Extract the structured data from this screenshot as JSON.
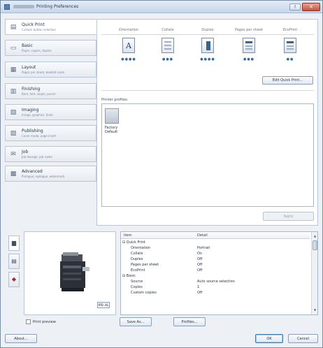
{
  "window": {
    "title": "Printing Preferences",
    "help_label": "?",
    "close_label": "✕"
  },
  "sidebar": {
    "items": [
      {
        "title": "Quick Print",
        "subtitle": "Custom button selection",
        "icon": "quick-print-icon",
        "glyph": "▤"
      },
      {
        "title": "Basic",
        "subtitle": "Paper, copies, duplex",
        "icon": "printer-icon",
        "glyph": "▭"
      },
      {
        "title": "Layout",
        "subtitle": "Pages per sheet, booklet scale",
        "icon": "layout-icon",
        "glyph": "▦"
      },
      {
        "title": "Finishing",
        "subtitle": "Bind, fold, staple, punch",
        "icon": "finishing-icon",
        "glyph": "▥"
      },
      {
        "title": "Imaging",
        "subtitle": "Image, graphics, fonts",
        "icon": "imaging-icon",
        "glyph": "▧"
      },
      {
        "title": "Publishing",
        "subtitle": "Cover mode, page insert",
        "icon": "publishing-icon",
        "glyph": "▨"
      },
      {
        "title": "Job",
        "subtitle": "Job storage, job name",
        "icon": "job-icon",
        "glyph": "✉"
      },
      {
        "title": "Advanced",
        "subtitle": "Prologue, epilogue, watermark",
        "icon": "advanced-icon",
        "glyph": "▩"
      }
    ]
  },
  "quick_print": {
    "items": [
      {
        "label": "Orientation",
        "glyph": "A",
        "dots": "●●●●",
        "icon": "orientation-icon"
      },
      {
        "label": "Collate",
        "glyph": "",
        "dots": "●●●",
        "icon": "collate-icon"
      },
      {
        "label": "Duplex",
        "glyph": "",
        "dots": "●●●●",
        "icon": "duplex-icon"
      },
      {
        "label": "Pages per sheet",
        "glyph": "",
        "dots": "●●●",
        "icon": "pages-per-sheet-icon"
      },
      {
        "label": "EcoPrint",
        "glyph": "",
        "dots": "●●",
        "icon": "ecoprint-icon"
      }
    ],
    "edit_label": "Edit Quick Print..."
  },
  "profiles": {
    "label": "Printer profiles:",
    "items": [
      {
        "name_line1": "Factory",
        "name_line2": "Default"
      }
    ],
    "apply_label": "Apply"
  },
  "lower": {
    "zoom_label": "IPD..XL",
    "side_tabs": [
      {
        "icon": "printer-tab-icon",
        "glyph": "▆"
      },
      {
        "icon": "document-tab-icon",
        "glyph": "▤"
      },
      {
        "icon": "color-tab-icon",
        "glyph": "◆"
      }
    ],
    "grid": {
      "col_item": "Item",
      "col_detail": "Detail",
      "rows": [
        {
          "indent": 0,
          "name": "⊟ Quick Print",
          "value": ""
        },
        {
          "indent": 1,
          "name": "Orientation",
          "value": "Portrait"
        },
        {
          "indent": 1,
          "name": "Collate",
          "value": "On"
        },
        {
          "indent": 1,
          "name": "Duplex",
          "value": "Off"
        },
        {
          "indent": 1,
          "name": "Pages per sheet",
          "value": "Off"
        },
        {
          "indent": 1,
          "name": "EcoPrint",
          "value": "Off"
        },
        {
          "indent": 0,
          "name": "⊟ Basic",
          "value": ""
        },
        {
          "indent": 1,
          "name": "Source",
          "value": "Auto source selection"
        },
        {
          "indent": 1,
          "name": "Copies",
          "value": "1"
        },
        {
          "indent": 1,
          "name": "Custom copies",
          "value": "Off"
        }
      ]
    },
    "save_as_label": "Save As...",
    "profiles_label": "Profiles..."
  },
  "footer": {
    "print_preview_label": "Print preview",
    "about_label": "About...",
    "ok_label": "OK",
    "cancel_label": "Cancel"
  }
}
